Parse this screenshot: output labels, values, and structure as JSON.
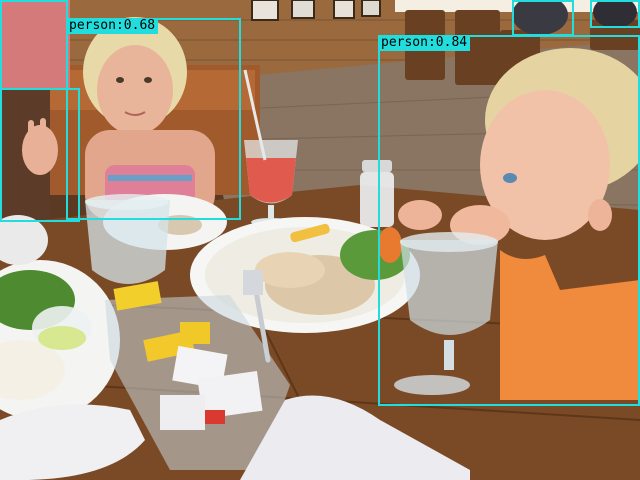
{
  "image": {
    "description_free": true
  },
  "colors": {
    "box": "#22dddd",
    "label_bg": "#22dddd",
    "label_text": "#000000"
  },
  "detections": [
    {
      "label": "person:0.68"
    },
    {
      "label": "person:0.84"
    }
  ]
}
